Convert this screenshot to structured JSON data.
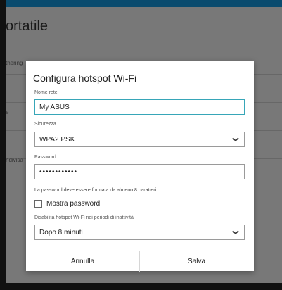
{
  "background": {
    "app_title_partial": "ortatile",
    "row_labels": [
      "thering",
      "e",
      "ndivisa"
    ]
  },
  "dialog": {
    "title": "Configura hotspot Wi-Fi",
    "network_name": {
      "label": "Nome rete",
      "value": "My ASUS"
    },
    "security": {
      "label": "Sicurezza",
      "selected": "WPA2 PSK"
    },
    "password": {
      "label": "Password",
      "masked_value": "••••••••••••",
      "helper": "La password deve essere formata da almeno 8 caratteri."
    },
    "show_password": {
      "label": "Mostra password",
      "checked": false
    },
    "disable_hotspot": {
      "label": "Disabilita hotspot Wi-Fi nei periodi di inattività",
      "selected": "Dopo 8 minuti"
    },
    "buttons": {
      "cancel": "Annulla",
      "save": "Salva"
    }
  },
  "colors": {
    "accent": "#37a6b8",
    "scrim": "rgba(0,0,0,0.5)",
    "topbar": "#0a4b6e"
  },
  "icons": {
    "dropdown": "chevron-down-icon",
    "checkbox": "checkbox-unchecked-icon"
  }
}
